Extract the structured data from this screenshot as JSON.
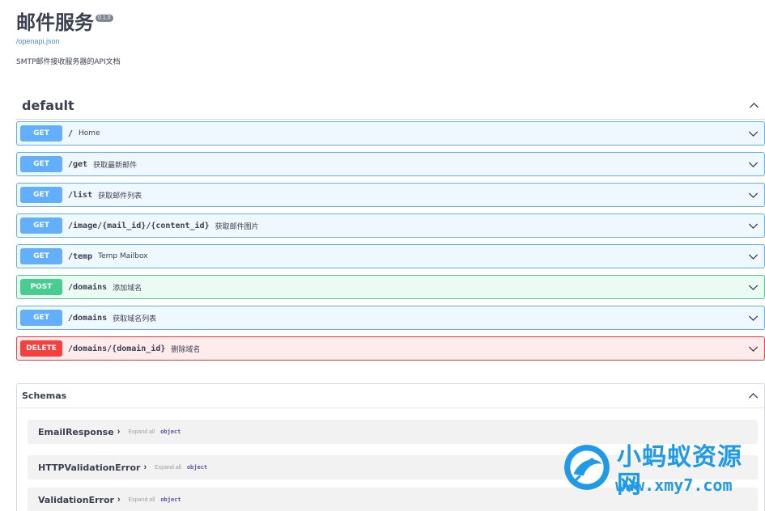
{
  "info": {
    "title": "邮件服务",
    "version": "0.1.0",
    "spec_link": "/openapi.json",
    "description": "SMTP邮件接收服务器的API文档"
  },
  "tag": {
    "name": "default"
  },
  "operations": [
    {
      "method": "GET",
      "path": "/",
      "summary": "Home"
    },
    {
      "method": "GET",
      "path": "/get",
      "summary": "获取最新邮件"
    },
    {
      "method": "GET",
      "path": "/list",
      "summary": "获取邮件列表"
    },
    {
      "method": "GET",
      "path": "/image/{mail_id}/{content_id}",
      "summary": "获取邮件图片"
    },
    {
      "method": "GET",
      "path": "/temp",
      "summary": "Temp Mailbox"
    },
    {
      "method": "POST",
      "path": "/domains",
      "summary": "添加域名"
    },
    {
      "method": "GET",
      "path": "/domains",
      "summary": "获取域名列表"
    },
    {
      "method": "DELETE",
      "path": "/domains/{domain_id}",
      "summary": "删除域名"
    }
  ],
  "schemas": {
    "title": "Schemas",
    "expand_label": "Expand all",
    "type_label": "object",
    "models": [
      {
        "name": "EmailResponse"
      },
      {
        "name": "HTTPValidationError"
      },
      {
        "name": "ValidationError"
      }
    ]
  },
  "watermark": {
    "name": "小蚂蚁资源网",
    "url": "www.xmy7.com"
  },
  "colors": {
    "get": "#61affe",
    "post": "#49cc90",
    "delete": "#f93e3e",
    "link": "#4990e2",
    "watermark": "#1f9ae8"
  },
  "icons": {
    "collapse": "chevron-up-icon",
    "expand": "chevron-down-icon",
    "model_toggle": "chevron-right-icon"
  }
}
